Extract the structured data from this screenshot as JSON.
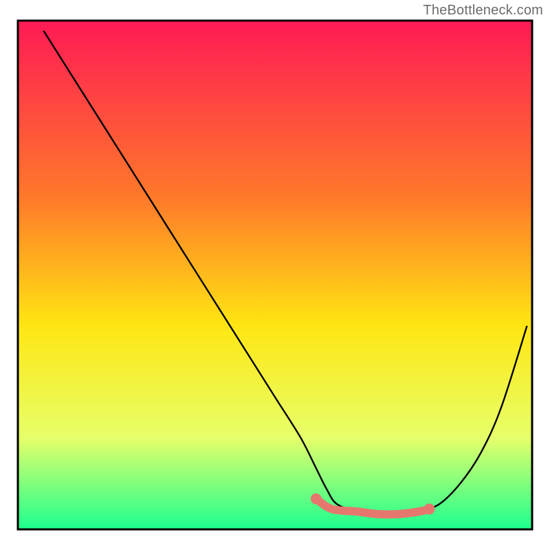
{
  "attribution": "TheBottleneck.com",
  "gradient": {
    "top": "#ff1a55",
    "upper_mid": "#ff7a2a",
    "mid": "#ffe612",
    "lower_mid": "#e6ff6a",
    "bottom": "#1cff8f"
  },
  "frame_color": "#000000",
  "curve_color": "#000000",
  "marker_color": "#e6776f",
  "chart_data": {
    "type": "line",
    "title": "",
    "xlabel": "",
    "ylabel": "",
    "xlim": [
      0,
      100
    ],
    "ylim": [
      0,
      100
    ],
    "series": [
      {
        "name": "bottleneck-curve",
        "x": [
          5,
          10,
          15,
          20,
          25,
          30,
          35,
          40,
          45,
          50,
          55,
          58,
          60,
          62,
          66,
          70,
          74,
          78,
          82,
          86,
          90,
          94,
          99
        ],
        "y": [
          98,
          90,
          82,
          74,
          66,
          58,
          50,
          42,
          34,
          26,
          18,
          12,
          8,
          5,
          3.5,
          3,
          3,
          3.5,
          5,
          9,
          15,
          24,
          40
        ]
      }
    ],
    "highlight": {
      "name": "sweet-spot",
      "x": [
        58,
        60,
        62,
        66,
        70,
        74,
        78,
        80
      ],
      "y": [
        6,
        4.5,
        3.8,
        3.5,
        3,
        3,
        3.5,
        4
      ]
    }
  }
}
